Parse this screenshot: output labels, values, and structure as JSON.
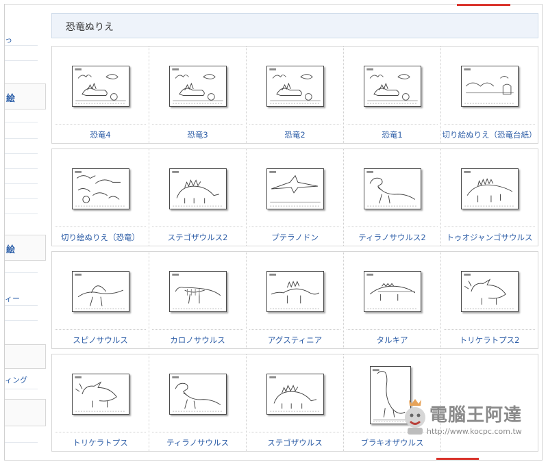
{
  "sidebar": {
    "fragments": [
      "っ",
      "絵",
      "絵",
      "ィー",
      "ィング"
    ]
  },
  "section": {
    "title": "恐竜ぬりえ"
  },
  "items": [
    {
      "label": "恐竜4",
      "icon": "dinosaur-scene-icon"
    },
    {
      "label": "恐竜3",
      "icon": "dinosaur-scene-icon"
    },
    {
      "label": "恐竜2",
      "icon": "dinosaur-scene-icon"
    },
    {
      "label": "恐竜1",
      "icon": "dinosaur-scene-icon"
    },
    {
      "label": "切り絵ぬりえ（恐竜台紙）",
      "icon": "background-scene-icon"
    },
    {
      "label": "切り絵ぬりえ（恐竜）",
      "icon": "dinosaur-cutouts-icon"
    },
    {
      "label": "ステゴザウルス2",
      "icon": "stegosaurus-icon"
    },
    {
      "label": "プテラノドン",
      "icon": "pteranodon-icon"
    },
    {
      "label": "ティラノサウルス2",
      "icon": "tyrannosaurus-icon"
    },
    {
      "label": "トゥオジャンゴサウルス",
      "icon": "tuojiangosaurus-icon"
    },
    {
      "label": "スピノサウルス",
      "icon": "spinosaurus-icon"
    },
    {
      "label": "カロノサウルス",
      "icon": "charonosaurus-icon"
    },
    {
      "label": "アグスティニア",
      "icon": "agustinia-icon"
    },
    {
      "label": "タルキア",
      "icon": "tarchia-icon"
    },
    {
      "label": "トリケラトプス2",
      "icon": "triceratops-icon"
    },
    {
      "label": "トリケラトプス",
      "icon": "triceratops-icon"
    },
    {
      "label": "ティラノサウルス",
      "icon": "tyrannosaurus-icon"
    },
    {
      "label": "ステゴザウルス",
      "icon": "stegosaurus-icon"
    },
    {
      "label": "ブラキオザウルス",
      "icon": "brachiosaurus-icon"
    }
  ],
  "watermark": {
    "title": "電腦王阿達",
    "url": "http://www.kocpc.com.tw"
  },
  "colors": {
    "link": "#2e5ea7",
    "header_bg": "#eef3fa",
    "accent_red": "#d9322a"
  }
}
